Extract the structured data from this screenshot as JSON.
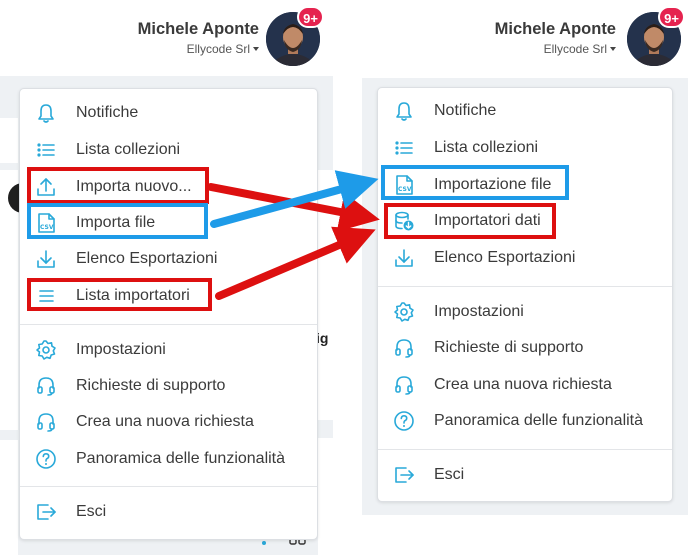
{
  "user": {
    "name": "Michele Aponte",
    "company": "Ellycode Srl",
    "notifications": "9+"
  },
  "left_menu": {
    "items": [
      {
        "label": "Notifiche",
        "icon": "bell-icon"
      },
      {
        "label": "Lista collezioni",
        "icon": "list-icon"
      },
      {
        "label": "Importa nuovo...",
        "icon": "upload-icon"
      },
      {
        "label": "Importa file",
        "icon": "csv-file-icon"
      },
      {
        "label": "Elenco Esportazioni",
        "icon": "download-icon"
      },
      {
        "label": "Lista importatori",
        "icon": "lines-icon"
      },
      {
        "label": "Impostazioni",
        "icon": "gear-icon"
      },
      {
        "label": "Richieste di supporto",
        "icon": "headset-icon"
      },
      {
        "label": "Crea una nuova richiesta",
        "icon": "headset-icon"
      },
      {
        "label": "Panoramica delle funzionalità",
        "icon": "help-circle-icon"
      },
      {
        "label": "Esci",
        "icon": "logout-icon"
      }
    ]
  },
  "right_menu": {
    "items": [
      {
        "label": "Notifiche",
        "icon": "bell-icon"
      },
      {
        "label": "Lista collezioni",
        "icon": "list-icon"
      },
      {
        "label": "Importazione file",
        "icon": "csv-file-icon"
      },
      {
        "label": "Importatori dati",
        "icon": "database-download-icon"
      },
      {
        "label": "Elenco Esportazioni",
        "icon": "download-icon"
      },
      {
        "label": "Impostazioni",
        "icon": "gear-icon"
      },
      {
        "label": "Richieste di supporto",
        "icon": "headset-icon"
      },
      {
        "label": "Crea una nuova richiesta",
        "icon": "headset-icon"
      },
      {
        "label": "Panoramica delle funzionalità",
        "icon": "help-circle-icon"
      },
      {
        "label": "Esci",
        "icon": "logout-icon"
      }
    ]
  },
  "background": {
    "partial_text": "ig"
  },
  "colors": {
    "accent": "#29a9d9",
    "highlight_red": "#dd1010",
    "highlight_blue": "#1e9be8",
    "badge": "#e5234f"
  }
}
